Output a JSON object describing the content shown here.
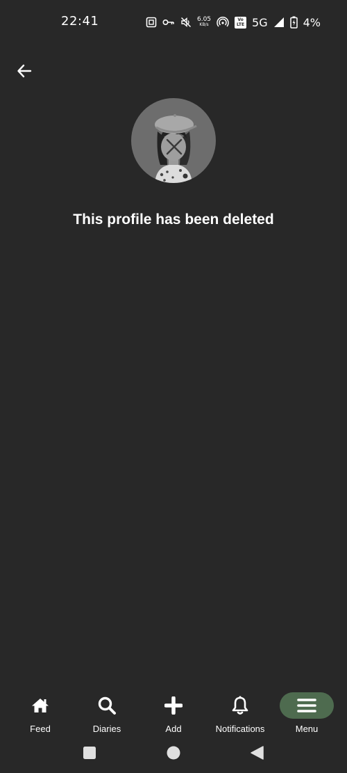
{
  "status_bar": {
    "time": "22:41",
    "speed_value": "6.05",
    "speed_unit": "KB/s",
    "volte_top": "Vo",
    "volte_bottom": "LTE",
    "network": "5G",
    "battery": "4%"
  },
  "page": {
    "message": "This profile has been deleted"
  },
  "nav": {
    "items": [
      {
        "label": "Feed",
        "icon": "home-icon"
      },
      {
        "label": "Diaries",
        "icon": "search-icon"
      },
      {
        "label": "Add",
        "icon": "plus-icon"
      },
      {
        "label": "Notifications",
        "icon": "bell-icon"
      },
      {
        "label": "Menu",
        "icon": "hamburger-icon",
        "active": true
      }
    ],
    "active_color": "#4e6b4f"
  },
  "colors": {
    "background": "#282828",
    "avatar_bg": "#6d6d6d"
  }
}
